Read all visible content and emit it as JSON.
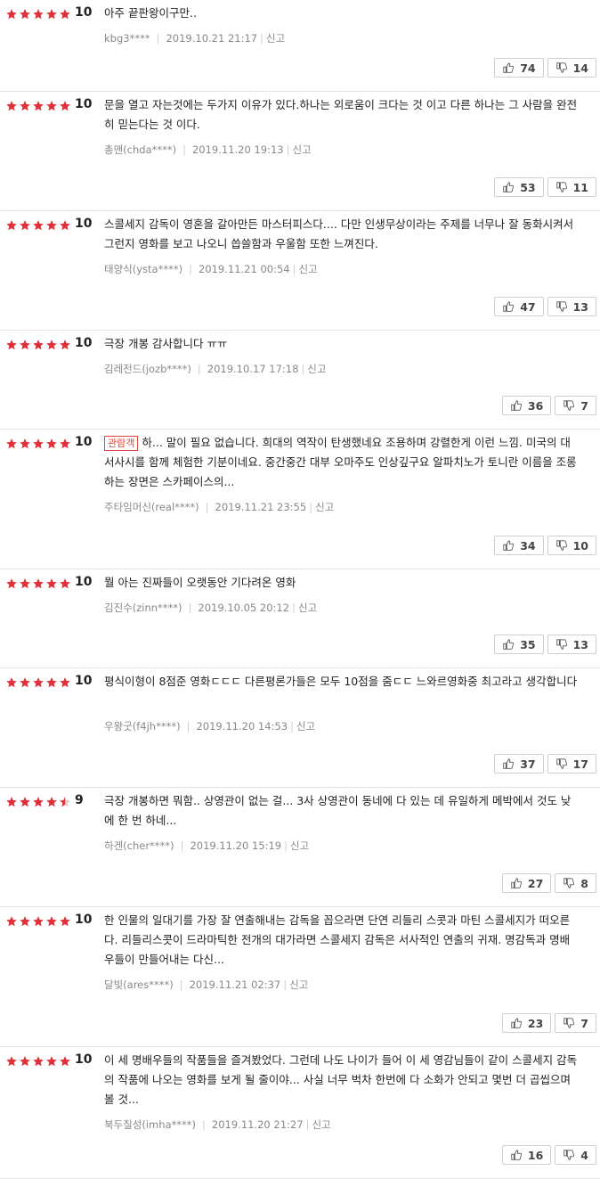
{
  "colors": {
    "star_full": "#e0303a",
    "star_empty": "#cccccc"
  },
  "report_label": "신고",
  "reviews": [
    {
      "stars": 5,
      "score": "10",
      "text": "아주 끝판왕이구만..",
      "badge": "",
      "user": "kbg3****",
      "date": "2019.10.21 21:17",
      "likes": "74",
      "dislikes": "14"
    },
    {
      "stars": 5,
      "score": "10",
      "text": "문을 열고 자는것에는 두가지 이유가 있다.하나는 외로움이 크다는 것 이고 다른 하나는 그 사람을 완전히 믿는다는 것 이다.",
      "badge": "",
      "user": "총맨(chda****)",
      "date": "2019.11.20 19:13",
      "likes": "53",
      "dislikes": "11"
    },
    {
      "stars": 5,
      "score": "10",
      "text": "스콜세지 감독이 영혼을 갈아만든 마스터피스다.... 다만 인생무상이라는 주제를 너무나 잘 동화시켜서 그런지 영화를 보고 나오니 씁쓸함과 우울함 또한 느껴진다.",
      "badge": "",
      "user": "태양식(ysta****)",
      "date": "2019.11.21 00:54",
      "likes": "47",
      "dislikes": "13"
    },
    {
      "stars": 5,
      "score": "10",
      "text": "극장 개봉 감사합니다 ㅠㅠ",
      "badge": "",
      "user": "김레전드(jozb****)",
      "date": "2019.10.17 17:18",
      "likes": "36",
      "dislikes": "7"
    },
    {
      "stars": 5,
      "score": "10",
      "text": "하... 말이 필요 없습니다. 희대의 역작이 탄생했네요 조용하며 강렬한게 이런 느낌. 미국의 대서사시를 함께 체험한 기분이네요. 중간중간 대부 오마주도 인상깊구요 알파치노가 토니란 이름을 조롱하는 장면은 스카페이스의...",
      "badge": "관람객",
      "user": "주타임머신(real****)",
      "date": "2019.11.21 23:55",
      "likes": "34",
      "dislikes": "10"
    },
    {
      "stars": 5,
      "score": "10",
      "text": "뭘 아는 진짜들이 오랫동안 기다려온 영화",
      "badge": "",
      "user": "김진수(zinn****)",
      "date": "2019.10.05 20:12",
      "likes": "35",
      "dislikes": "13"
    },
    {
      "stars": 5,
      "score": "10",
      "text": "평식이형이 8점준 영화ㄷㄷㄷ 다른평론가들은 모두 10점을 줌ㄷㄷ 느와르영화중 최고라고 생각합니다",
      "badge": "",
      "user": "우왕굿(f4jh****)",
      "date": "2019.11.20 14:53",
      "likes": "37",
      "dislikes": "17"
    },
    {
      "stars": 4.5,
      "score": "9",
      "text": "극장 개봉하면 뭐함.. 상영관이 없는 걸... 3사 상영관이 동네에 다 있는 데 유일하게 메박에서 것도 낮에 한 번 하네...",
      "badge": "",
      "user": "하겐(cher****)",
      "date": "2019.11.20 15:19",
      "likes": "27",
      "dislikes": "8"
    },
    {
      "stars": 5,
      "score": "10",
      "text": "한 인물의 일대기를 가장 잘 연출해내는 감독을 꼽으라면 단연 리들리 스콧과 마틴 스콜세지가 떠오른다. 리들리스콧이 드라마틱한 전개의 대가라면 스콜세지 감독은 서사적인 연출의 귀재. 명감독과 명배우들이 만들어내는 다신...",
      "badge": "",
      "user": "달빛(ares****)",
      "date": "2019.11.21 02:37",
      "likes": "23",
      "dislikes": "7"
    },
    {
      "stars": 5,
      "score": "10",
      "text": "이 세 명배우들의 작품들을 즐겨봤었다. 그런데 나도 나이가 들어 이 세 영감님들이 같이 스콜세지 감독의 작품에 나오는 영화를 보게 될 줄이야... 사실 너무 벅차 한번에 다 소화가 안되고 몇번 더 곱씹으며 볼 것...",
      "badge": "",
      "user": "북두칠성(imha****)",
      "date": "2019.11.20 21:27",
      "likes": "16",
      "dislikes": "4"
    }
  ]
}
